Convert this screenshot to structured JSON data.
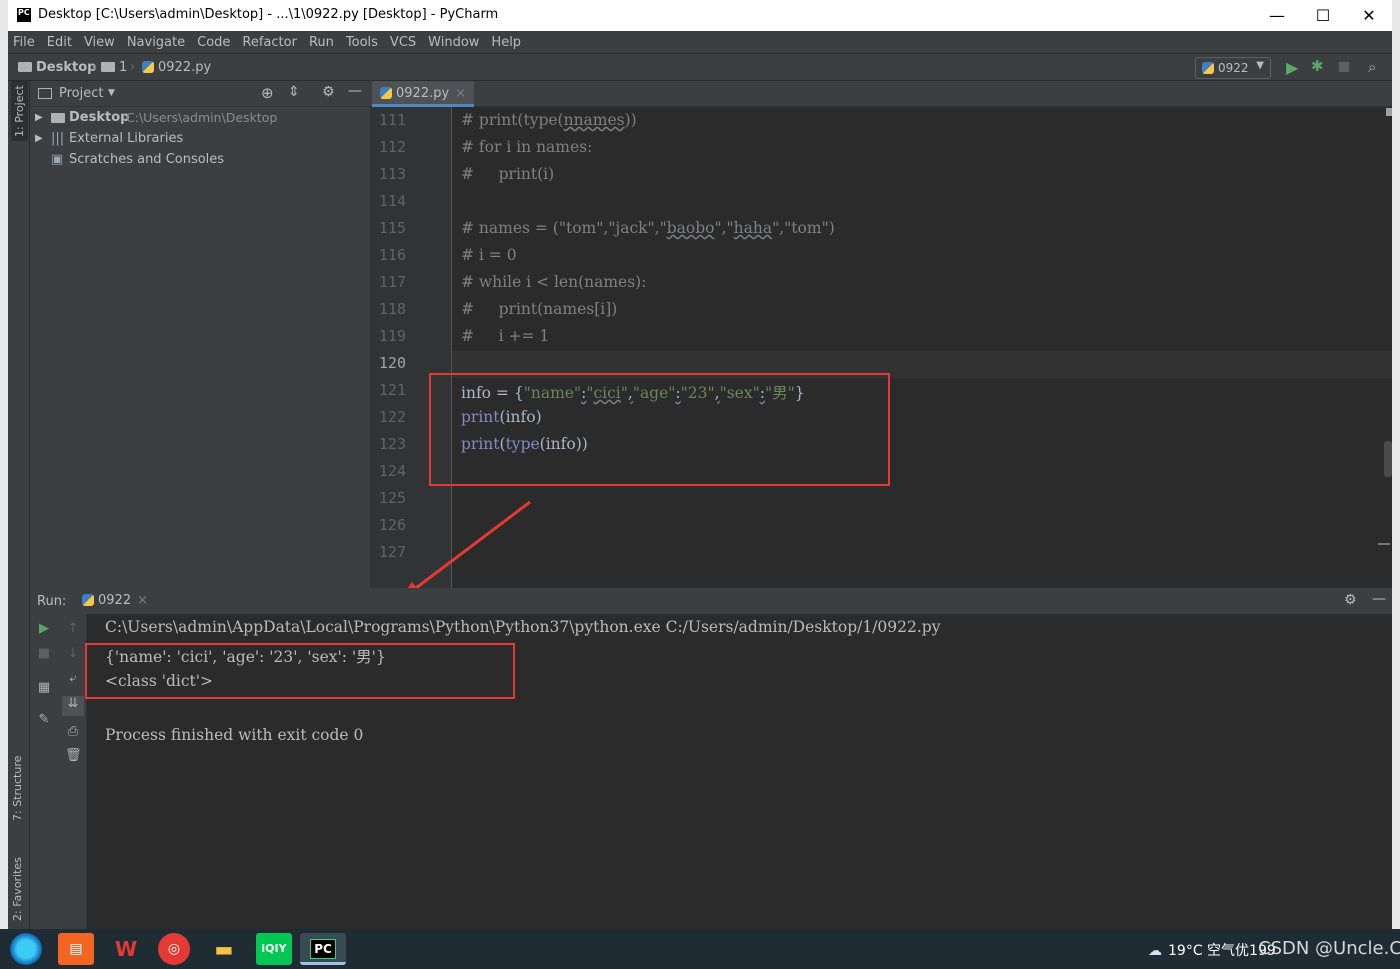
{
  "window": {
    "title": "Desktop [C:\\Users\\admin\\Desktop] - ...\\1\\0922.py [Desktop] - PyCharm",
    "logo": "PC",
    "minimize": "—",
    "maximize": "☐",
    "close": "✕"
  },
  "menu": [
    "File",
    "Edit",
    "View",
    "Navigate",
    "Code",
    "Refactor",
    "Run",
    "Tools",
    "VCS",
    "Window",
    "Help"
  ],
  "breadcrumb": {
    "root": "Desktop",
    "folder": "1",
    "file": "0922.py"
  },
  "run_config": "0922",
  "side_tabs": {
    "project": "1: Project",
    "structure": "7: Structure",
    "favorites": "2: Favorites"
  },
  "project": {
    "title": "Project",
    "tree": [
      {
        "name": "Desktop",
        "path": "C:\\Users\\admin\\Desktop"
      },
      {
        "name": "External Libraries",
        "path": ""
      },
      {
        "name": "Scratches and Consoles",
        "path": ""
      }
    ]
  },
  "editor": {
    "tab": "0922.py",
    "lines": [
      {
        "n": "111",
        "tokens": [
          {
            "t": "# print(type(",
            "k": "comment"
          },
          {
            "t": "nnames",
            "k": "comment",
            "u": true
          },
          {
            "t": "))",
            "k": "comment"
          }
        ]
      },
      {
        "n": "112",
        "tokens": [
          {
            "t": "# for i in names:",
            "k": "comment"
          }
        ]
      },
      {
        "n": "113",
        "tokens": [
          {
            "t": "#     print(i)",
            "k": "comment"
          }
        ]
      },
      {
        "n": "114",
        "tokens": []
      },
      {
        "n": "115",
        "tokens": [
          {
            "t": "# names = (\"tom\",\"jack\",\"",
            "k": "comment"
          },
          {
            "t": "baobo",
            "k": "comment",
            "u": true
          },
          {
            "t": "\",\"",
            "k": "comment"
          },
          {
            "t": "haha",
            "k": "comment",
            "u": true
          },
          {
            "t": "\",\"tom\")",
            "k": "comment"
          }
        ]
      },
      {
        "n": "116",
        "tokens": [
          {
            "t": "# i = 0",
            "k": "comment"
          }
        ]
      },
      {
        "n": "117",
        "tokens": [
          {
            "t": "# while i < len(names):",
            "k": "comment"
          }
        ]
      },
      {
        "n": "118",
        "tokens": [
          {
            "t": "#     print(names[i])",
            "k": "comment"
          }
        ]
      },
      {
        "n": "119",
        "tokens": [
          {
            "t": "#     i += 1",
            "k": "comment"
          }
        ]
      },
      {
        "n": "120",
        "tokens": []
      },
      {
        "n": "121",
        "tokens": [
          {
            "t": "info = {",
            "k": "plain"
          },
          {
            "t": "\"name\"",
            "k": "str"
          },
          {
            "t": ":",
            "k": "plain",
            "u": true
          },
          {
            "t": "\"",
            "k": "str"
          },
          {
            "t": "cici",
            "k": "str",
            "u": true
          },
          {
            "t": "\"",
            "k": "str"
          },
          {
            "t": ",",
            "k": "plain",
            "u": true
          },
          {
            "t": "\"age\"",
            "k": "str"
          },
          {
            "t": ":",
            "k": "plain",
            "u": true
          },
          {
            "t": "\"23\"",
            "k": "str"
          },
          {
            "t": ",",
            "k": "plain",
            "u": true
          },
          {
            "t": "\"sex\"",
            "k": "str"
          },
          {
            "t": ":",
            "k": "plain",
            "u": true
          },
          {
            "t": "\"男\"",
            "k": "str"
          },
          {
            "t": "}",
            "k": "plain"
          }
        ]
      },
      {
        "n": "122",
        "tokens": [
          {
            "t": "print",
            "k": "builtin"
          },
          {
            "t": "(info)",
            "k": "plain"
          }
        ]
      },
      {
        "n": "123",
        "tokens": [
          {
            "t": "print",
            "k": "builtin"
          },
          {
            "t": "(",
            "k": "plain"
          },
          {
            "t": "type",
            "k": "builtin"
          },
          {
            "t": "(info))",
            "k": "plain"
          }
        ]
      },
      {
        "n": "124",
        "tokens": []
      },
      {
        "n": "125",
        "tokens": []
      },
      {
        "n": "126",
        "tokens": []
      },
      {
        "n": "127",
        "tokens": []
      }
    ]
  },
  "run": {
    "label": "Run:",
    "tab": "0922",
    "output": [
      "C:\\Users\\admin\\AppData\\Local\\Programs\\Python\\Python37\\python.exe C:/Users/admin/Desktop/1/0922.py",
      "{'name': 'cici', 'age': '23', 'sex': '男'}",
      "<class 'dict'>",
      "",
      "Process finished with exit code 0"
    ]
  },
  "taskbar": {
    "weather": "19°C 空气优199",
    "watermark": "CSDN @Uncle.Ci"
  },
  "colors": {
    "accent": "#4a88c7",
    "highlight_box": "#e53935",
    "comment": "#808080",
    "string": "#6a8759",
    "builtin": "#8888c6"
  }
}
